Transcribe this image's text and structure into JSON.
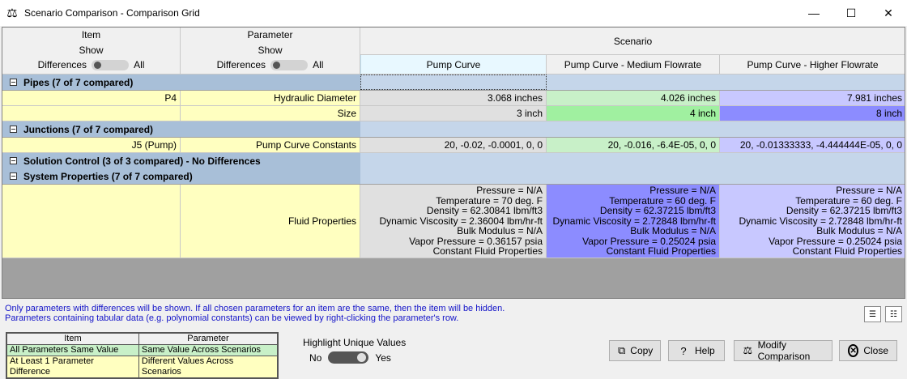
{
  "window": {
    "title": "Scenario Comparison - Comparison Grid",
    "app_icon": "balance-scale-icon",
    "minimize_glyph": "—",
    "maximize_glyph": "☐",
    "close_glyph": "✕"
  },
  "header": {
    "item": {
      "title": "Item",
      "show": "Show",
      "left": "Differences",
      "right": "All"
    },
    "parameter": {
      "title": "Parameter",
      "show": "Show",
      "left": "Differences",
      "right": "All"
    },
    "scenario": "Scenario",
    "columns": [
      "Pump Curve",
      "Pump Curve - Medium Flowrate",
      "Pump Curve - Higher Flowrate"
    ]
  },
  "groups": [
    {
      "label": "Pipes (7 of 7 compared)"
    },
    {
      "label": "Junctions (7 of 7 compared)"
    },
    {
      "label": "Solution Control (3 of 3 compared) - No Differences"
    },
    {
      "label": "System Properties (7 of 7 compared)"
    }
  ],
  "rows": {
    "p4_diam": {
      "item": "P4",
      "param": "Hydraulic Diameter",
      "v1": "3.068 inches",
      "v2": "4.026 inches",
      "v3": "7.981 inches"
    },
    "p4_size": {
      "item": "",
      "param": "Size",
      "v1": "3 inch",
      "v2": "4 inch",
      "v3": "8 inch"
    },
    "j5": {
      "item": "J5 (Pump)",
      "param": "Pump Curve Constants",
      "v1": "20, -0.02, -0.0001, 0, 0",
      "v2": "20, -0.016, -6.4E-05, 0, 0",
      "v3": "20, -0.01333333, -4.444444E-05, 0, 0"
    },
    "fluid": {
      "item": "",
      "param": "Fluid Properties",
      "v1": [
        "Pressure = N/A",
        "Temperature = 70 deg. F",
        "Density = 62.30841 lbm/ft3",
        "Dynamic Viscosity = 2.36004 lbm/hr-ft",
        "Bulk Modulus = N/A",
        "Vapor Pressure = 0.36157 psia",
        "Constant Fluid Properties"
      ],
      "v2": [
        "Pressure = N/A",
        "Temperature = 60 deg. F",
        "Density = 62.37215 lbm/ft3",
        "Dynamic Viscosity = 2.72848 lbm/hr-ft",
        "Bulk Modulus = N/A",
        "Vapor Pressure = 0.25024 psia",
        "Constant Fluid Properties"
      ],
      "v3": [
        "Pressure = N/A",
        "Temperature = 60 deg. F",
        "Density = 62.37215 lbm/ft3",
        "Dynamic Viscosity = 2.72848 lbm/hr-ft",
        "Bulk Modulus = N/A",
        "Vapor Pressure = 0.25024 psia",
        "Constant Fluid Properties"
      ]
    }
  },
  "info": {
    "line1": "Only parameters with differences will be shown. If all chosen parameters for an item are the same, then the item will be hidden.",
    "line2": "Parameters containing tabular data (e.g. polynomial constants) can be viewed by right-clicking the parameter's row."
  },
  "legend": {
    "item_head": "Item",
    "param_head": "Parameter",
    "item_same": "All Parameters Same Value",
    "param_same": "Same Value Across Scenarios",
    "item_diff": "At Least 1 Parameter Difference",
    "param_diff": "Different Values Across Scenarios"
  },
  "highlight": {
    "title": "Highlight Unique Values",
    "no": "No",
    "yes": "Yes",
    "state": "Yes"
  },
  "buttons": {
    "copy": "Copy",
    "help": "Help",
    "modify": "Modify Comparison",
    "close": "Close"
  },
  "colors": {
    "item_cell": "#ffffc0",
    "same_value": "#e0e0e0",
    "diff_green_light": "#c8f0c8",
    "diff_green": "#a0f0a0",
    "diff_purple_light": "#c8c8ff",
    "diff_purple": "#8c8cff",
    "group_header": "#a8bfd8",
    "info_text": "#1414c8"
  }
}
